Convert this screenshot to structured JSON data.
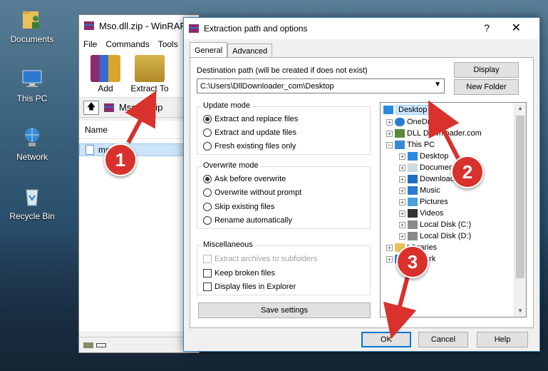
{
  "desktop": {
    "icons": [
      {
        "label": "Documents"
      },
      {
        "label": "This PC"
      },
      {
        "label": "Network"
      },
      {
        "label": "Recycle Bin"
      }
    ]
  },
  "winrar": {
    "title": "Mso.dll.zip - WinRAR",
    "menu": [
      "File",
      "Commands",
      "Tools"
    ],
    "toolbar": {
      "add_label": "Add",
      "extract_label": "Extract To"
    },
    "path": "Mso.dll.zip",
    "column_name": "Name",
    "file_row": "mso"
  },
  "dialog": {
    "title": "Extraction path and options",
    "help": "?",
    "close": "✕",
    "tabs": [
      "General",
      "Advanced"
    ],
    "destination_label": "Destination path (will be created if does not exist)",
    "destination_value": "C:\\Users\\DllDownloader_com\\Desktop",
    "display_button": "Display",
    "new_folder_button": "New Folder",
    "update_mode": {
      "title": "Update mode",
      "options": [
        "Extract and replace files",
        "Extract and update files",
        "Fresh existing files only"
      ]
    },
    "overwrite_mode": {
      "title": "Overwrite mode",
      "options": [
        "Ask before overwrite",
        "Overwrite without prompt",
        "Skip existing files",
        "Rename automatically"
      ]
    },
    "misc": {
      "title": "Miscellaneous",
      "options": [
        "Extract archives to subfolders",
        "Keep broken files",
        "Display files in Explorer"
      ]
    },
    "save_settings": "Save settings",
    "ok": "OK",
    "cancel": "Cancel",
    "help_button": "Help",
    "tree": {
      "desktop": "Desktop",
      "onedrive": "OneDrive",
      "dll": "DLL Downloader.com",
      "thispc": "This PC",
      "pc_desktop": "Desktop",
      "documents": "Documents",
      "downloads": "Downloads",
      "music": "Music",
      "pictures": "Pictures",
      "videos": "Videos",
      "disk_c": "Local Disk (C:)",
      "disk_d": "Local Disk (D:)",
      "libraries": "Libraries",
      "network": "Network"
    }
  },
  "annotations": {
    "step1": "1",
    "step2": "2",
    "step3": "3"
  },
  "colors": {
    "accent": "#0078d7",
    "badge": "#d9312b",
    "selection": "#cce8ff"
  }
}
